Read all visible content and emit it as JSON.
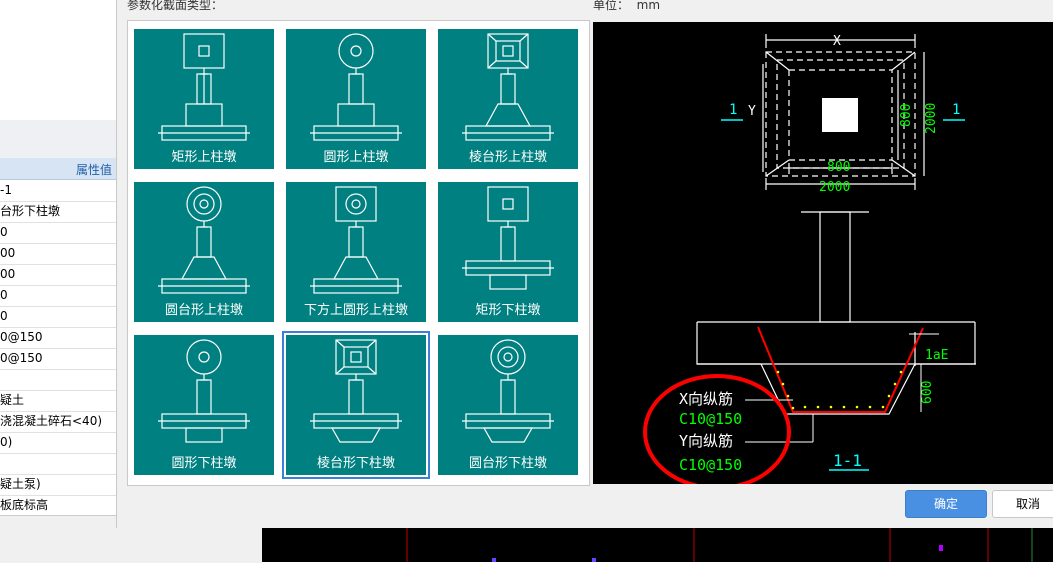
{
  "background_panel": {
    "header_label": "属性值",
    "rows": [
      "-1",
      "台形下柱墩",
      "0",
      "00",
      "00",
      "0",
      "0",
      "0@150",
      "0@150",
      "",
      "疑土",
      "浇混凝土碎石<40)",
      "0)",
      "",
      "疑土泵)",
      "板底标高"
    ]
  },
  "dialog": {
    "section_type_label": "参数化截面类型：",
    "unit_label": "单位：",
    "unit_value": "mm",
    "tiles": [
      {
        "caption": "矩形上柱墩",
        "icon": "rect-upper-pier-icon"
      },
      {
        "caption": "圆形上柱墩",
        "icon": "circle-upper-pier-icon"
      },
      {
        "caption": "棱台形上柱墩",
        "icon": "frustum-upper-pier-icon"
      },
      {
        "caption": "圆台形上柱墩",
        "icon": "round-frustum-upper-pier-icon"
      },
      {
        "caption": "下方上圆形上柱墩",
        "icon": "square-round-upper-pier-icon"
      },
      {
        "caption": "矩形下柱墩",
        "icon": "rect-lower-pier-icon"
      },
      {
        "caption": "圆形下柱墩",
        "icon": "circle-lower-pier-icon"
      },
      {
        "caption": "棱台形下柱墩",
        "icon": "frustum-lower-pier-icon"
      },
      {
        "caption": "圆台形下柱墩",
        "icon": "round-frustum-lower-pier-icon"
      }
    ],
    "selected_tile": "棱台形下柱墩",
    "preview": {
      "dim_x": "X",
      "dim_y": "Y",
      "dim_800_h": "800",
      "dim_2000_h": "2000",
      "dim_800_v": "800",
      "dim_2000_v": "2000",
      "section_mark_left": "1",
      "section_mark_right": "1",
      "lae_label": "1aE",
      "depth_label": "600",
      "x_rebar_label": "X向纵筋",
      "x_rebar_value": "C10@150",
      "y_rebar_label": "Y向纵筋",
      "y_rebar_value": "C10@150",
      "section_title": "1-1"
    },
    "ok_label": "确定",
    "cancel_label": "取消"
  },
  "colors": {
    "tile_bg": "#008080",
    "selection": "#3a80d6",
    "cad_green": "#00ff00",
    "cad_cyan": "#00ffff",
    "rebar_red": "#ff0000",
    "rebar_dots": "#ffff00",
    "ok_button": "#4a90e2"
  }
}
